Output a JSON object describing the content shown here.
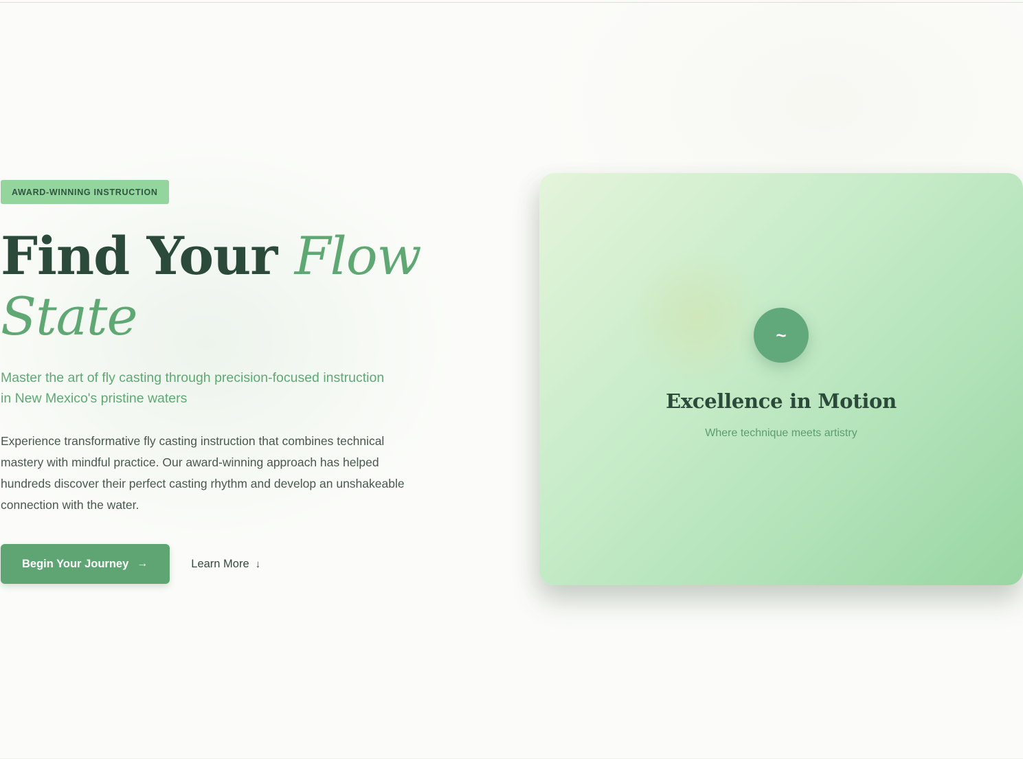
{
  "hero": {
    "badge": "AWARD-WINNING INSTRUCTION",
    "headline_main": "Find Your ",
    "headline_accent": "Flow State",
    "lead": "Master the art of fly casting through precision-focused instruction in New Mexico's pristine waters",
    "body": "Experience transformative fly casting instruction that combines technical mastery with mindful practice. Our award-winning approach has helped hundreds discover their perfect casting rhythm and develop an unshakeable connection with the water.",
    "primary_cta": "Begin Your Journey",
    "primary_cta_arrow": "→",
    "secondary_cta": "Learn More",
    "secondary_cta_arrow": "↓"
  },
  "feature_card": {
    "icon_glyph": "~",
    "icon": "wave-icon",
    "title": "Excellence in Motion",
    "subtitle": "Where technique meets artistry"
  },
  "colors": {
    "accent": "#5fa873",
    "dark_text": "#2c4a3a",
    "badge_bg": "#93d59d",
    "button_bg": "#5fa574"
  }
}
